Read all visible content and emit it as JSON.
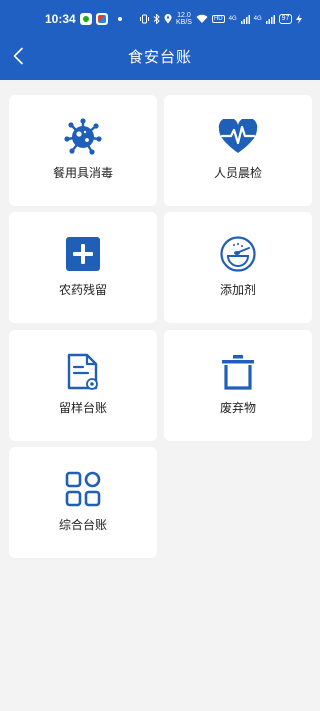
{
  "status_bar": {
    "time": "10:34",
    "speed": "12.0\nKB/S",
    "network_badge": "HD",
    "signal_1": "4G",
    "signal_2": "4G",
    "battery": "97"
  },
  "header": {
    "title": "食安台账"
  },
  "menu": [
    {
      "label": "餐用具消毒",
      "icon": "virus-icon"
    },
    {
      "label": "人员晨检",
      "icon": "heart-pulse-icon"
    },
    {
      "label": "农药残留",
      "icon": "plus-square-icon"
    },
    {
      "label": "添加剂",
      "icon": "spoon-bowl-icon"
    },
    {
      "label": "留样台账",
      "icon": "document-icon"
    },
    {
      "label": "废弃物",
      "icon": "trash-icon"
    },
    {
      "label": "综合台账",
      "icon": "grid-icon"
    }
  ],
  "colors": {
    "primary": "#2060c2",
    "background": "#f4f3f4",
    "card": "#ffffff"
  }
}
